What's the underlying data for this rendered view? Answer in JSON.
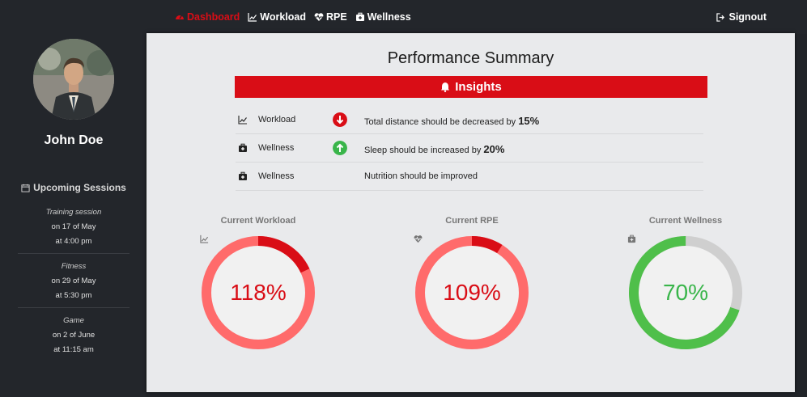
{
  "nav": {
    "items": [
      {
        "label": "Dashboard",
        "icon": "dashboard-icon",
        "active": true
      },
      {
        "label": "Workload",
        "icon": "chart-line-icon",
        "active": false
      },
      {
        "label": "RPE",
        "icon": "heartbeat-icon",
        "active": false
      },
      {
        "label": "Wellness",
        "icon": "medkit-icon",
        "active": false
      }
    ],
    "signout": "Signout"
  },
  "sidebar": {
    "name": "John Doe",
    "sessions_title": "Upcoming Sessions",
    "sessions": [
      {
        "type": "Training session",
        "date": "on 17 of May",
        "time": "at 4:00 pm"
      },
      {
        "type": "Fitness",
        "date": "on 29 of May",
        "time": "at 5:30 pm"
      },
      {
        "type": "Game",
        "date": "on 2 of June",
        "time": "at 11:15 am"
      }
    ]
  },
  "main": {
    "title": "Performance Summary",
    "insights_label": "Insights",
    "insights": [
      {
        "category": "Workload",
        "icon": "chart-line-icon",
        "direction": "down",
        "text": "Total distance should be decreased by ",
        "pct": "15%"
      },
      {
        "category": "Wellness",
        "icon": "medkit-icon",
        "direction": "up",
        "text": "Sleep should be increased by ",
        "pct": "20%"
      },
      {
        "category": "Wellness",
        "icon": "medkit-icon",
        "direction": "none",
        "text": "Nutrition should be improved",
        "pct": ""
      }
    ],
    "gauges": [
      {
        "label": "Current Workload",
        "icon": "chart-line-icon",
        "value_text": "118%",
        "value": 118,
        "color": "#d90d16",
        "ring": "#ff6b6b"
      },
      {
        "label": "Current RPE",
        "icon": "heartbeat-icon",
        "value_text": "109%",
        "value": 109,
        "color": "#d90d16",
        "ring": "#ff6b6b"
      },
      {
        "label": "Current Wellness",
        "icon": "medkit-icon",
        "value_text": "70%",
        "value": 70,
        "color": "#39b54a",
        "ring": "#4fbf4a"
      }
    ]
  },
  "colors": {
    "accent": "#d90d16",
    "good": "#39b54a",
    "sidebar": "#23262b",
    "panel": "#e9eaec"
  }
}
